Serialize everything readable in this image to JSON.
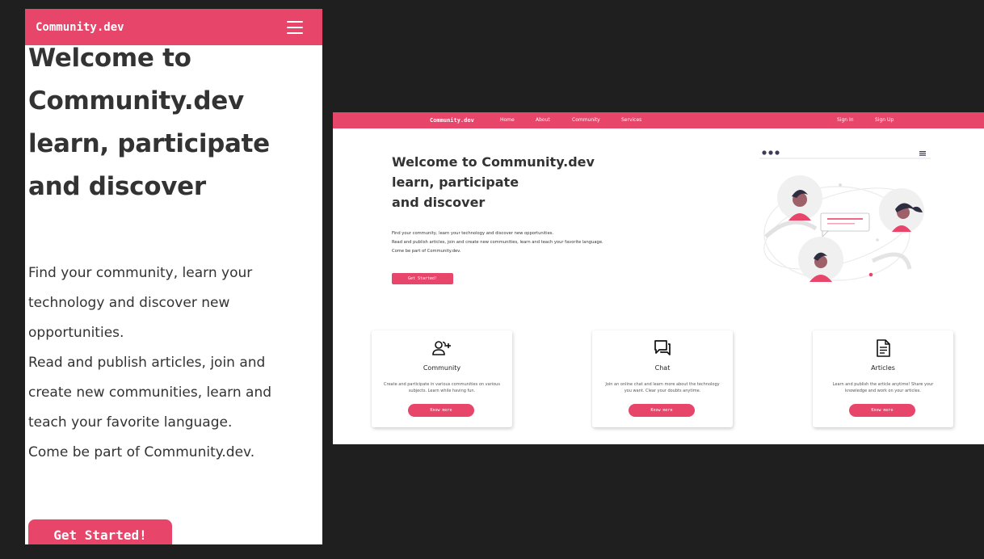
{
  "brand": "Community.dev",
  "colors": {
    "accent": "#e8456b",
    "text": "#333333",
    "frame": "#1f1f1f"
  },
  "mobile": {
    "title_lines": [
      "Welcome to",
      "Community.dev",
      "learn, participate",
      "and discover"
    ],
    "desc_lines": [
      "Find your community, learn your",
      "technology and discover new",
      "opportunities.",
      "Read and publish articles, join and",
      "create new communities, learn and",
      "teach your favorite language.",
      "Come be part of Community.dev."
    ],
    "cta": "Get Started!",
    "menu_icon": "hamburger-icon"
  },
  "desktop": {
    "nav": {
      "home": "Home",
      "about": "About",
      "community": "Community",
      "services": "Services",
      "sign_in": "Sign In",
      "sign_up": "Sign Up"
    },
    "title_lines": [
      "Welcome to Community.dev",
      "learn, participate",
      "and discover"
    ],
    "desc_lines": [
      "Find your community, learn your technology and discover new opportunities.",
      "Read and publish articles, join and create new communities, learn and teach your favorite language.",
      "Come be part of Community.dev."
    ],
    "cta": "Get Started!",
    "cards": [
      {
        "icon": "add-user-icon",
        "title": "Community",
        "text_lines": [
          "Create and participate in various communities on various",
          "subjects. Learn while having fun."
        ],
        "button": "Know more"
      },
      {
        "icon": "chat-icon",
        "title": "Chat",
        "text_lines": [
          "Join an online chat and learn more about the technology",
          "you want. Clear your doubts anytime."
        ],
        "button": "Know more"
      },
      {
        "icon": "article-icon",
        "title": "Articles",
        "text_lines": [
          "Learn and publish the article anytime! Share your",
          "knowledge and work on your articles."
        ],
        "button": "Know more"
      }
    ]
  }
}
